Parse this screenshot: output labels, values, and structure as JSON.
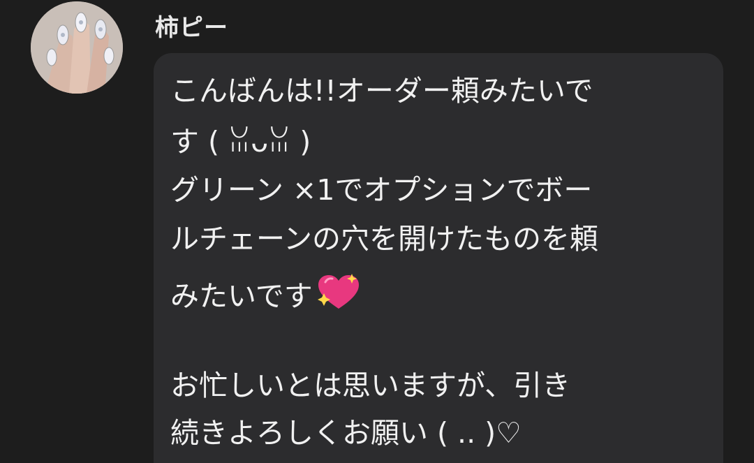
{
  "sender": {
    "name": "柿ピー",
    "avatar_icon": "avatar-photo-nails"
  },
  "message": {
    "lines": [
      "こんばんは!!オーダー頼みたいで",
      "す ( ꈍᴗꈍ )",
      "グリーン ×1でオプションでボー",
      "ルチェーンの穴を開けたものを頼",
      "みたいです",
      "お忙しいとは思いますが、引き",
      "続きよろしくお願い ( .. )♡"
    ],
    "emoji_icon": "sparkling-heart-icon"
  },
  "colors": {
    "background": "#1d1d1d",
    "bubble": "#2c2c2e",
    "text": "#f1f1f1",
    "heart": "#e8387f"
  }
}
